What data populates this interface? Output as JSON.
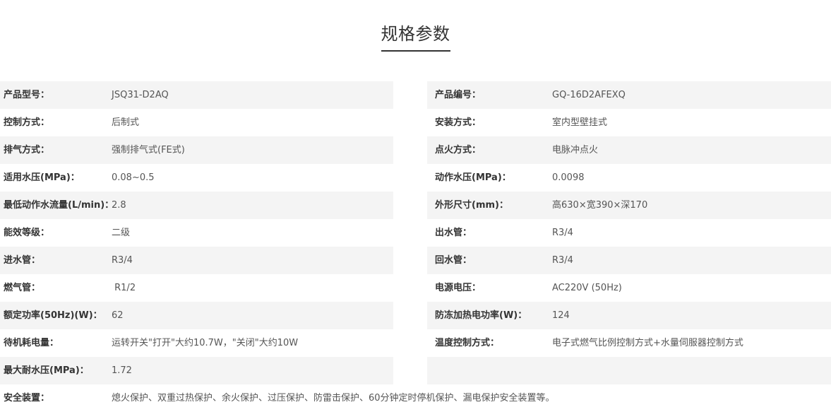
{
  "title": "规格参数",
  "rows": [
    {
      "left": {
        "label": "产品型号：",
        "value": "JSQ31-D2AQ"
      },
      "right": {
        "label": "产品编号：",
        "value": "GQ-16D2AFEXQ"
      }
    },
    {
      "left": {
        "label": "控制方式：",
        "value": "后制式"
      },
      "right": {
        "label": "安装方式：",
        "value": "室内型壁挂式"
      }
    },
    {
      "left": {
        "label": "排气方式：",
        "value": "强制排气式(FE式)"
      },
      "right": {
        "label": "点火方式：",
        "value": "电脉冲点火"
      }
    },
    {
      "left": {
        "label": "适用水压(MPa)：",
        "value": "0.08~0.5"
      },
      "right": {
        "label": "动作水压(MPa)：",
        "value": "0.0098"
      }
    },
    {
      "left": {
        "label": "最低动作水流量(L/min)：",
        "value": "2.8"
      },
      "right": {
        "label": "外形尺寸(mm)：",
        "value": "高630×宽390×深170"
      }
    },
    {
      "left": {
        "label": "能效等级：",
        "value": "二级"
      },
      "right": {
        "label": "出水管：",
        "value": "R3/4"
      }
    },
    {
      "left": {
        "label": "进水管：",
        "value": "R3/4"
      },
      "right": {
        "label": "回水管：",
        "value": "R3/4"
      }
    },
    {
      "left": {
        "label": "燃气管：",
        "value": " R1/2"
      },
      "right": {
        "label": "电源电压：",
        "value": "AC220V (50Hz)"
      }
    },
    {
      "left": {
        "label": "额定功率(50Hz)(W)：",
        "value": "62"
      },
      "right": {
        "label": "防冻加热电功率(W)：",
        "value": "124"
      }
    },
    {
      "left": {
        "label": "待机耗电量：",
        "value": "运转开关\"打开\"大约10.7W，\"关闭\"大约10W"
      },
      "right": {
        "label": "温度控制方式：",
        "value": "电子式燃气比例控制方式+水量伺服器控制方式"
      }
    },
    {
      "left": {
        "label": "最大耐水压(MPa)：",
        "value": "1.72"
      },
      "right": {
        "label": "",
        "value": ""
      }
    }
  ],
  "footer_row": {
    "label": "安全装置：",
    "value": "熄火保护、双重过热保护、余火保护、过压保护、防雷击保护、60分钟定时停机保护、漏电保护安全装置等。"
  }
}
